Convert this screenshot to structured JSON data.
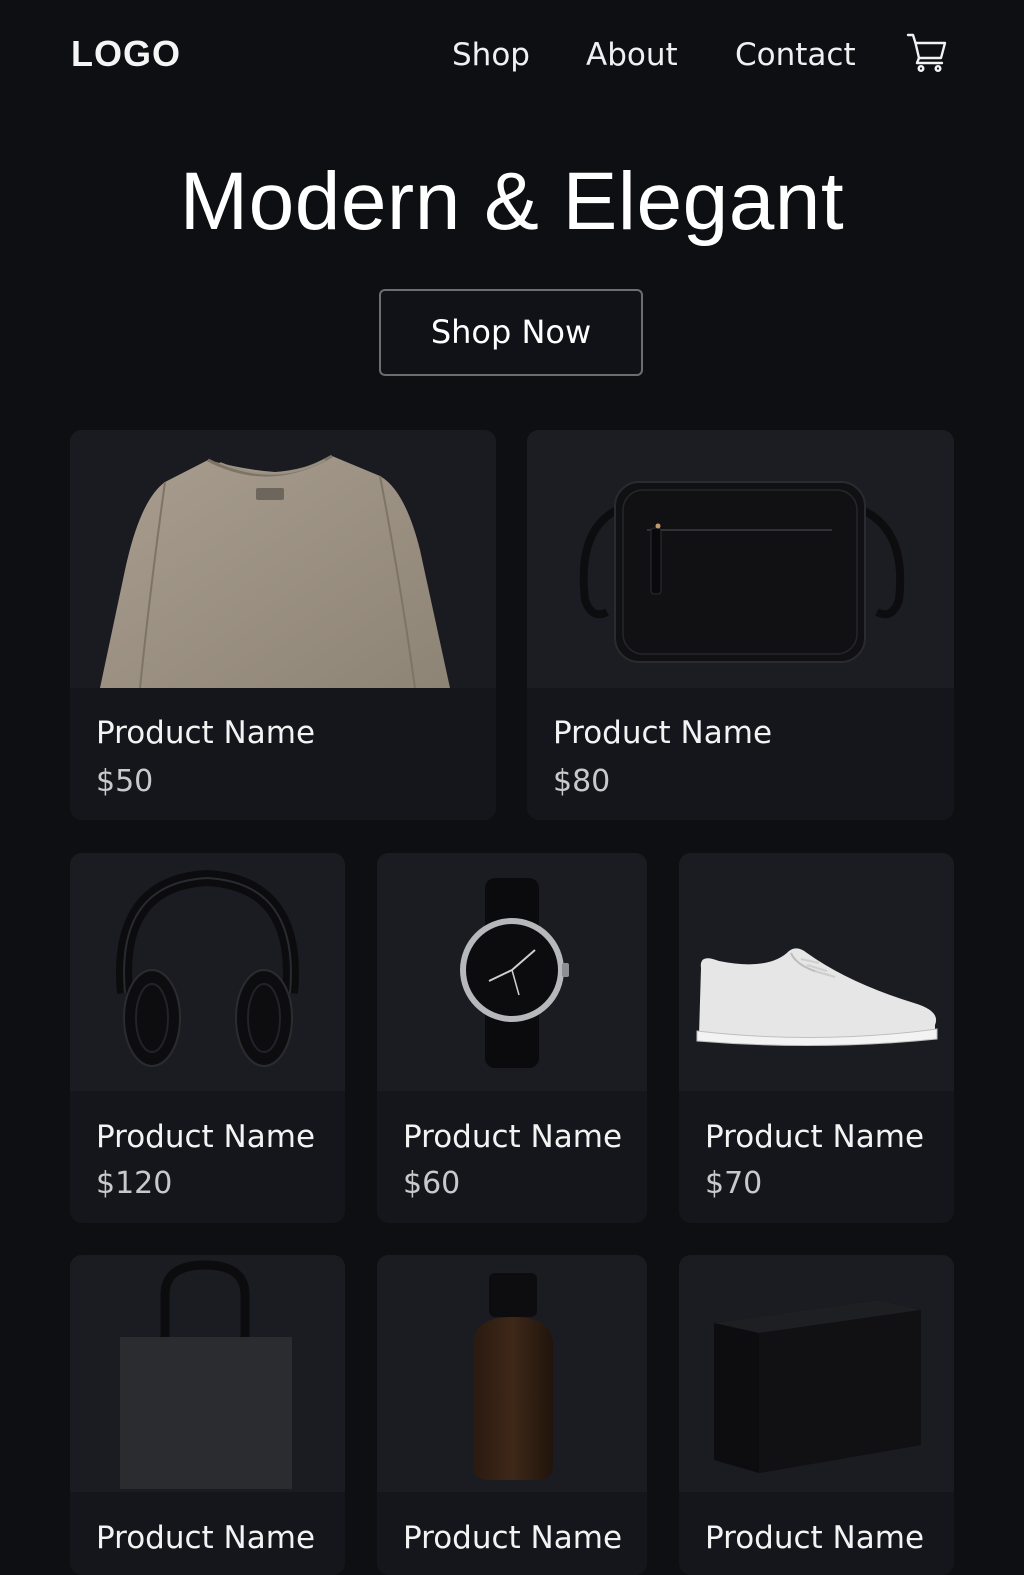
{
  "header": {
    "logo": "LOGO",
    "nav": [
      "Shop",
      "About",
      "Contact"
    ],
    "cart_icon": "shopping-cart-icon"
  },
  "hero": {
    "title": "Modern & Elegant",
    "cta_label": "Shop Now"
  },
  "products": [
    {
      "name": "Product Name",
      "price": "$50",
      "image": "sweatshirt"
    },
    {
      "name": "Product Name",
      "price": "$80",
      "image": "crossbody-bag"
    },
    {
      "name": "Product Name",
      "price": "$120",
      "image": "headphones"
    },
    {
      "name": "Product Name",
      "price": "$60",
      "image": "wristwatch"
    },
    {
      "name": "Product Name",
      "price": "$70",
      "image": "sneaker"
    },
    {
      "name": "Product Name",
      "image": "tote-bag"
    },
    {
      "name": "Product Name",
      "image": "amber-bottle"
    },
    {
      "name": "Product Name",
      "image": "black-box"
    }
  ],
  "colors": {
    "background": "#0e0f13",
    "card": "#15161b",
    "text": "#f2f2f2",
    "muted_text": "#c9c9cc",
    "button_border": "#6b6d73"
  }
}
